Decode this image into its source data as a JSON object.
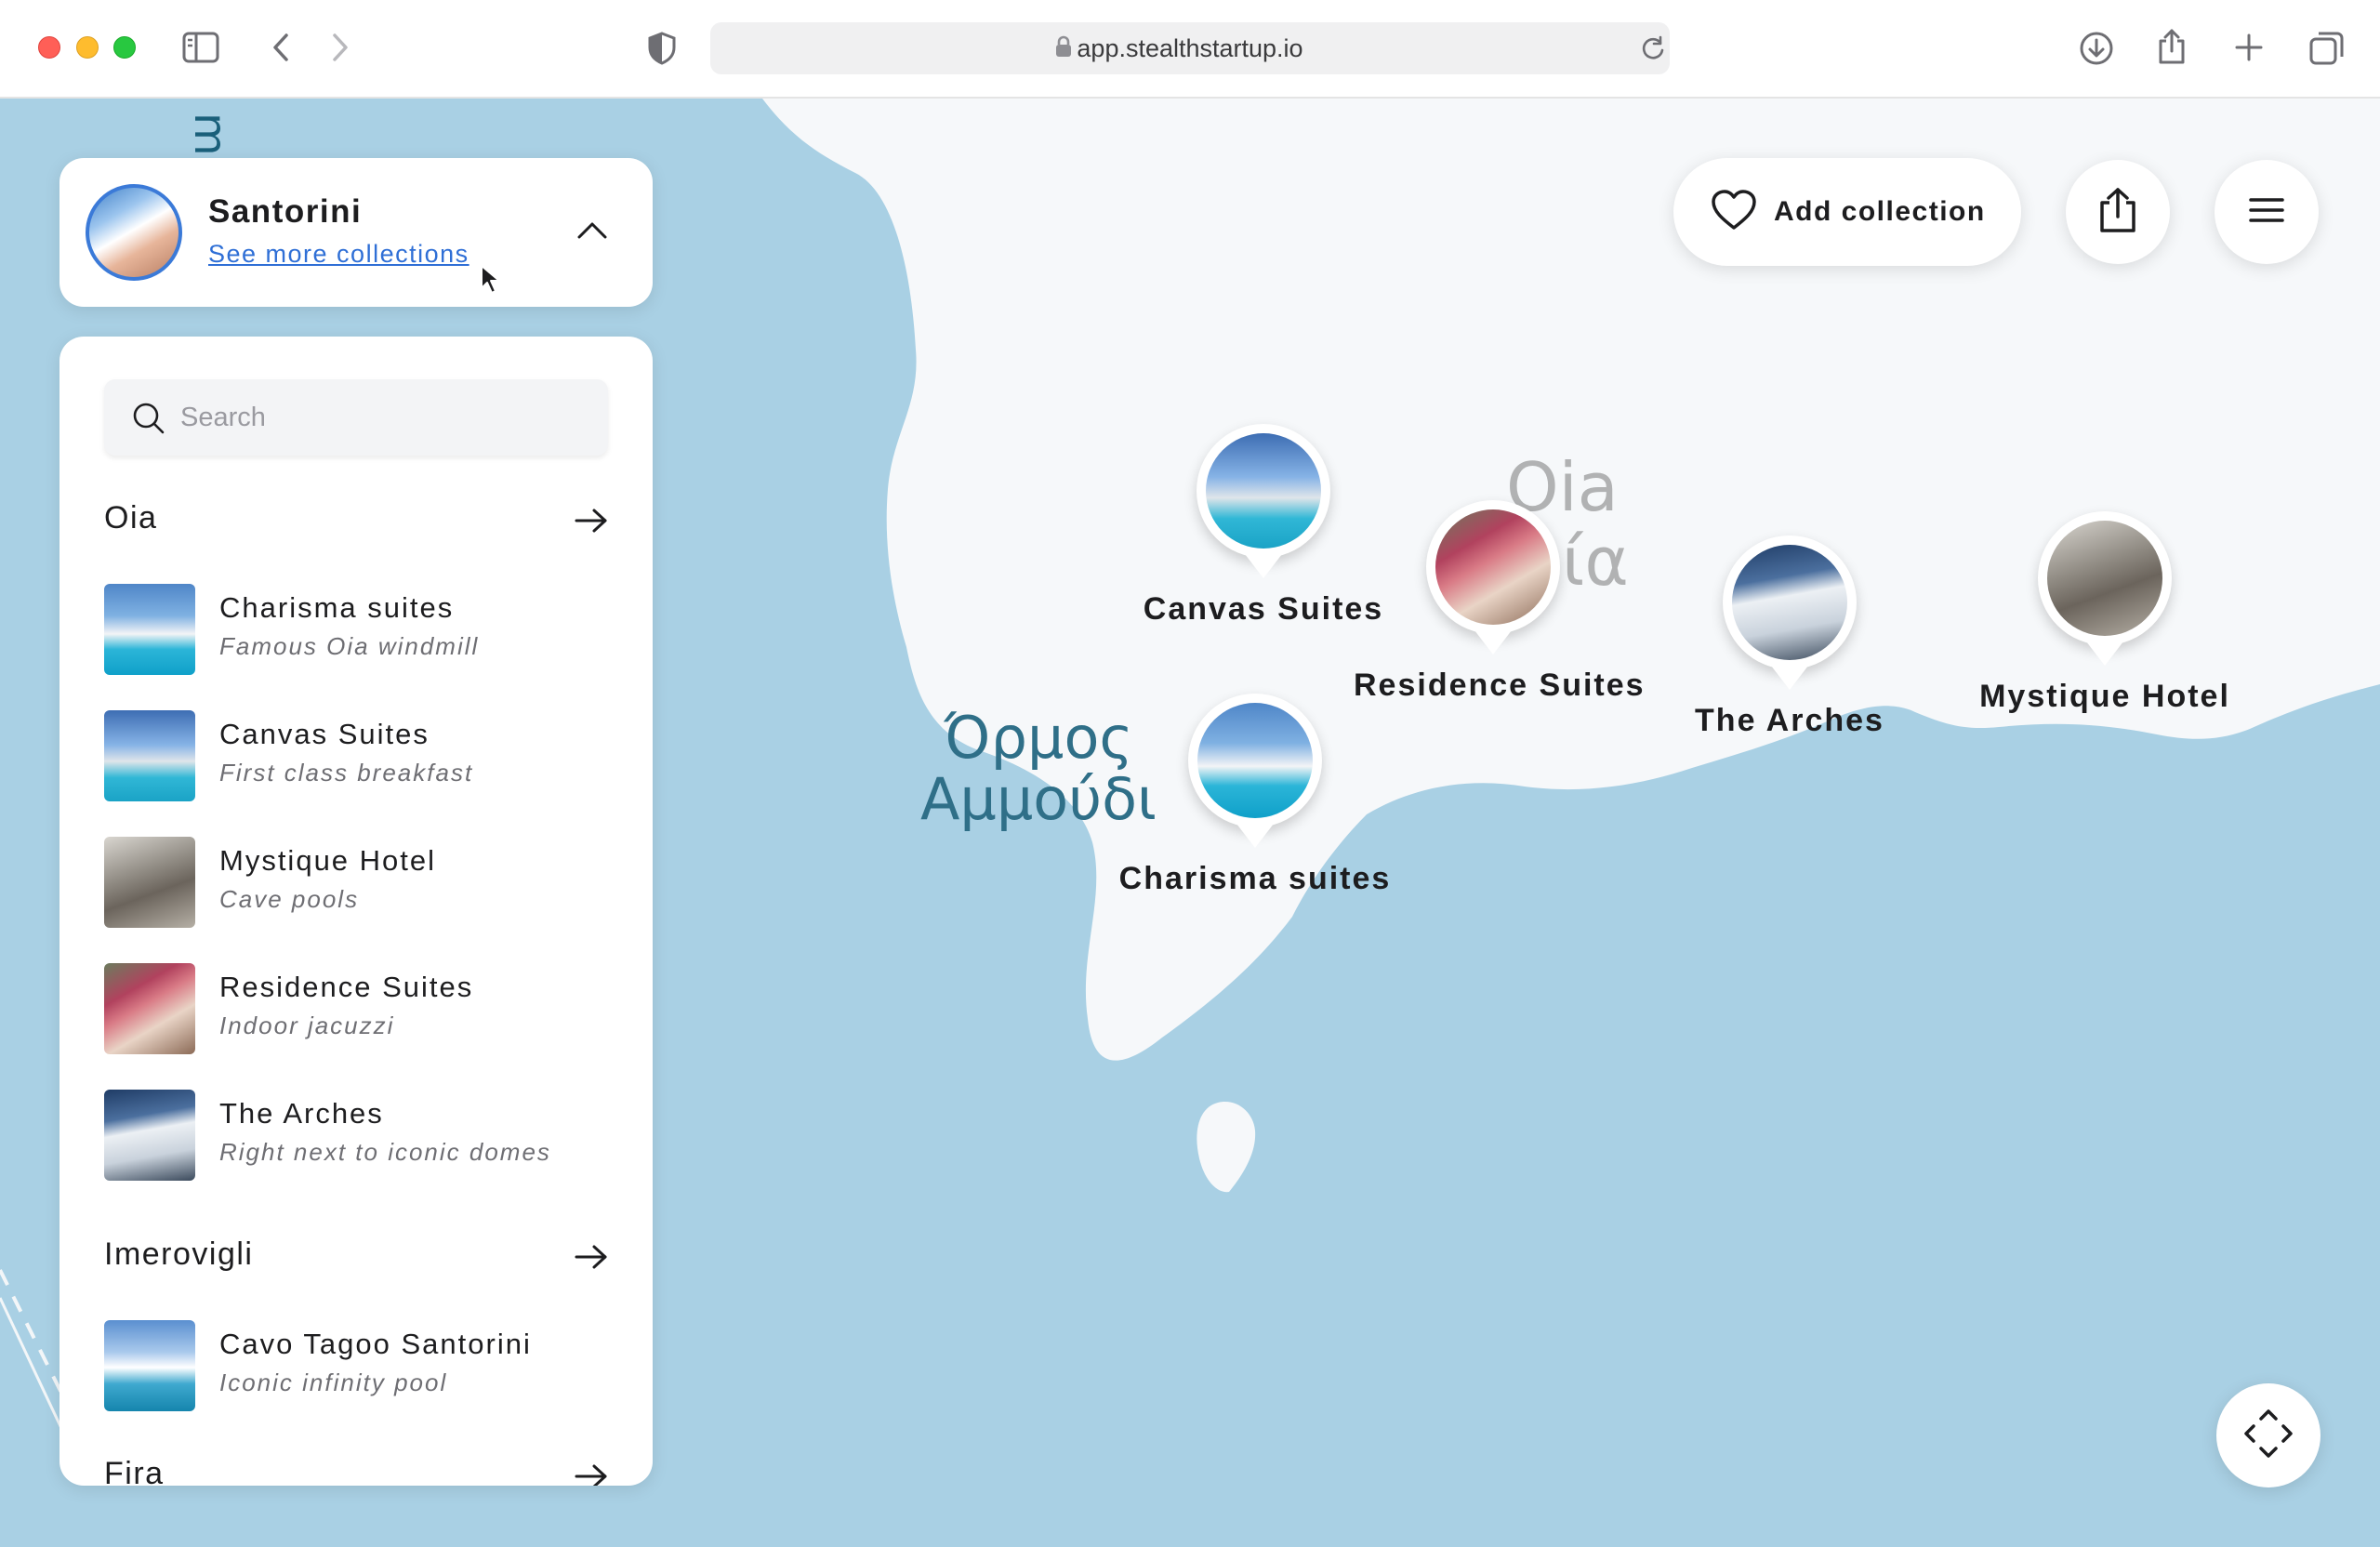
{
  "browser": {
    "url": "app.stealthstartup.io"
  },
  "map": {
    "bay_label_line1": "Όρμος",
    "bay_label_line2": "Αμμούδι",
    "town_label_line1": "Oia",
    "town_label_line2": "ία",
    "pins": [
      {
        "label": "Canvas Suites",
        "photo": "canvas-suites-photo"
      },
      {
        "label": "Residence Suites",
        "photo": "residence-suites-photo"
      },
      {
        "label": "The Arches",
        "photo": "the-arches-photo"
      },
      {
        "label": "Mystique Hotel",
        "photo": "mystique-hotel-photo"
      },
      {
        "label": "Charisma suites",
        "photo": "charisma-suites-photo"
      }
    ]
  },
  "toolbar": {
    "add_collection_label": "Add collection",
    "icons": [
      "heart-icon",
      "share-icon",
      "menu-icon",
      "recenter-icon"
    ]
  },
  "collection": {
    "title": "Santorini",
    "more_link": "See more collections"
  },
  "panel": {
    "search_placeholder": "Search",
    "sections": [
      {
        "title": "Oia",
        "items": [
          {
            "name": "Charisma suites",
            "subtitle": "Famous Oia windmill"
          },
          {
            "name": "Canvas Suites",
            "subtitle": "First class breakfast"
          },
          {
            "name": "Mystique Hotel",
            "subtitle": "Cave pools"
          },
          {
            "name": "Residence Suites",
            "subtitle": "Indoor jacuzzi"
          },
          {
            "name": "The Arches",
            "subtitle": "Right next to iconic domes"
          }
        ]
      },
      {
        "title": "Imerovigli",
        "items": [
          {
            "name": "Cavo Tagoo Santorini",
            "subtitle": "Iconic infinity pool"
          }
        ]
      },
      {
        "title": "Fira",
        "items": []
      }
    ]
  },
  "colors": {
    "sea": "#a9d0e4",
    "land": "#f6f8fa",
    "accent_link": "#2f6fd6",
    "text_primary": "#1d1d1f",
    "text_secondary": "#6e6e73"
  }
}
